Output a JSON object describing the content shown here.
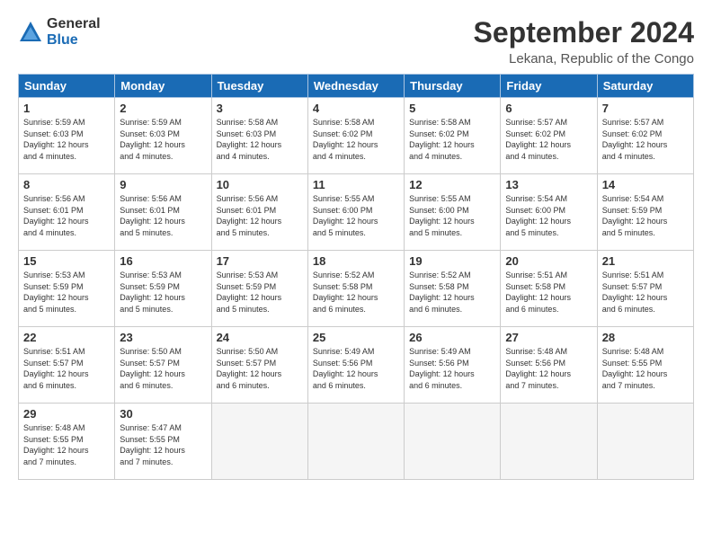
{
  "logo": {
    "line1": "General",
    "line2": "Blue"
  },
  "title": "September 2024",
  "subtitle": "Lekana, Republic of the Congo",
  "days_of_week": [
    "Sunday",
    "Monday",
    "Tuesday",
    "Wednesday",
    "Thursday",
    "Friday",
    "Saturday"
  ],
  "weeks": [
    [
      {
        "day": "1",
        "lines": [
          "Sunrise: 5:59 AM",
          "Sunset: 6:03 PM",
          "Daylight: 12 hours",
          "and 4 minutes."
        ]
      },
      {
        "day": "2",
        "lines": [
          "Sunrise: 5:59 AM",
          "Sunset: 6:03 PM",
          "Daylight: 12 hours",
          "and 4 minutes."
        ]
      },
      {
        "day": "3",
        "lines": [
          "Sunrise: 5:58 AM",
          "Sunset: 6:03 PM",
          "Daylight: 12 hours",
          "and 4 minutes."
        ]
      },
      {
        "day": "4",
        "lines": [
          "Sunrise: 5:58 AM",
          "Sunset: 6:02 PM",
          "Daylight: 12 hours",
          "and 4 minutes."
        ]
      },
      {
        "day": "5",
        "lines": [
          "Sunrise: 5:58 AM",
          "Sunset: 6:02 PM",
          "Daylight: 12 hours",
          "and 4 minutes."
        ]
      },
      {
        "day": "6",
        "lines": [
          "Sunrise: 5:57 AM",
          "Sunset: 6:02 PM",
          "Daylight: 12 hours",
          "and 4 minutes."
        ]
      },
      {
        "day": "7",
        "lines": [
          "Sunrise: 5:57 AM",
          "Sunset: 6:02 PM",
          "Daylight: 12 hours",
          "and 4 minutes."
        ]
      }
    ],
    [
      {
        "day": "8",
        "lines": [
          "Sunrise: 5:56 AM",
          "Sunset: 6:01 PM",
          "Daylight: 12 hours",
          "and 4 minutes."
        ]
      },
      {
        "day": "9",
        "lines": [
          "Sunrise: 5:56 AM",
          "Sunset: 6:01 PM",
          "Daylight: 12 hours",
          "and 5 minutes."
        ]
      },
      {
        "day": "10",
        "lines": [
          "Sunrise: 5:56 AM",
          "Sunset: 6:01 PM",
          "Daylight: 12 hours",
          "and 5 minutes."
        ]
      },
      {
        "day": "11",
        "lines": [
          "Sunrise: 5:55 AM",
          "Sunset: 6:00 PM",
          "Daylight: 12 hours",
          "and 5 minutes."
        ]
      },
      {
        "day": "12",
        "lines": [
          "Sunrise: 5:55 AM",
          "Sunset: 6:00 PM",
          "Daylight: 12 hours",
          "and 5 minutes."
        ]
      },
      {
        "day": "13",
        "lines": [
          "Sunrise: 5:54 AM",
          "Sunset: 6:00 PM",
          "Daylight: 12 hours",
          "and 5 minutes."
        ]
      },
      {
        "day": "14",
        "lines": [
          "Sunrise: 5:54 AM",
          "Sunset: 5:59 PM",
          "Daylight: 12 hours",
          "and 5 minutes."
        ]
      }
    ],
    [
      {
        "day": "15",
        "lines": [
          "Sunrise: 5:53 AM",
          "Sunset: 5:59 PM",
          "Daylight: 12 hours",
          "and 5 minutes."
        ]
      },
      {
        "day": "16",
        "lines": [
          "Sunrise: 5:53 AM",
          "Sunset: 5:59 PM",
          "Daylight: 12 hours",
          "and 5 minutes."
        ]
      },
      {
        "day": "17",
        "lines": [
          "Sunrise: 5:53 AM",
          "Sunset: 5:59 PM",
          "Daylight: 12 hours",
          "and 5 minutes."
        ]
      },
      {
        "day": "18",
        "lines": [
          "Sunrise: 5:52 AM",
          "Sunset: 5:58 PM",
          "Daylight: 12 hours",
          "and 6 minutes."
        ]
      },
      {
        "day": "19",
        "lines": [
          "Sunrise: 5:52 AM",
          "Sunset: 5:58 PM",
          "Daylight: 12 hours",
          "and 6 minutes."
        ]
      },
      {
        "day": "20",
        "lines": [
          "Sunrise: 5:51 AM",
          "Sunset: 5:58 PM",
          "Daylight: 12 hours",
          "and 6 minutes."
        ]
      },
      {
        "day": "21",
        "lines": [
          "Sunrise: 5:51 AM",
          "Sunset: 5:57 PM",
          "Daylight: 12 hours",
          "and 6 minutes."
        ]
      }
    ],
    [
      {
        "day": "22",
        "lines": [
          "Sunrise: 5:51 AM",
          "Sunset: 5:57 PM",
          "Daylight: 12 hours",
          "and 6 minutes."
        ]
      },
      {
        "day": "23",
        "lines": [
          "Sunrise: 5:50 AM",
          "Sunset: 5:57 PM",
          "Daylight: 12 hours",
          "and 6 minutes."
        ]
      },
      {
        "day": "24",
        "lines": [
          "Sunrise: 5:50 AM",
          "Sunset: 5:57 PM",
          "Daylight: 12 hours",
          "and 6 minutes."
        ]
      },
      {
        "day": "25",
        "lines": [
          "Sunrise: 5:49 AM",
          "Sunset: 5:56 PM",
          "Daylight: 12 hours",
          "and 6 minutes."
        ]
      },
      {
        "day": "26",
        "lines": [
          "Sunrise: 5:49 AM",
          "Sunset: 5:56 PM",
          "Daylight: 12 hours",
          "and 6 minutes."
        ]
      },
      {
        "day": "27",
        "lines": [
          "Sunrise: 5:48 AM",
          "Sunset: 5:56 PM",
          "Daylight: 12 hours",
          "and 7 minutes."
        ]
      },
      {
        "day": "28",
        "lines": [
          "Sunrise: 5:48 AM",
          "Sunset: 5:55 PM",
          "Daylight: 12 hours",
          "and 7 minutes."
        ]
      }
    ],
    [
      {
        "day": "29",
        "lines": [
          "Sunrise: 5:48 AM",
          "Sunset: 5:55 PM",
          "Daylight: 12 hours",
          "and 7 minutes."
        ]
      },
      {
        "day": "30",
        "lines": [
          "Sunrise: 5:47 AM",
          "Sunset: 5:55 PM",
          "Daylight: 12 hours",
          "and 7 minutes."
        ]
      },
      {
        "day": "",
        "lines": []
      },
      {
        "day": "",
        "lines": []
      },
      {
        "day": "",
        "lines": []
      },
      {
        "day": "",
        "lines": []
      },
      {
        "day": "",
        "lines": []
      }
    ]
  ]
}
